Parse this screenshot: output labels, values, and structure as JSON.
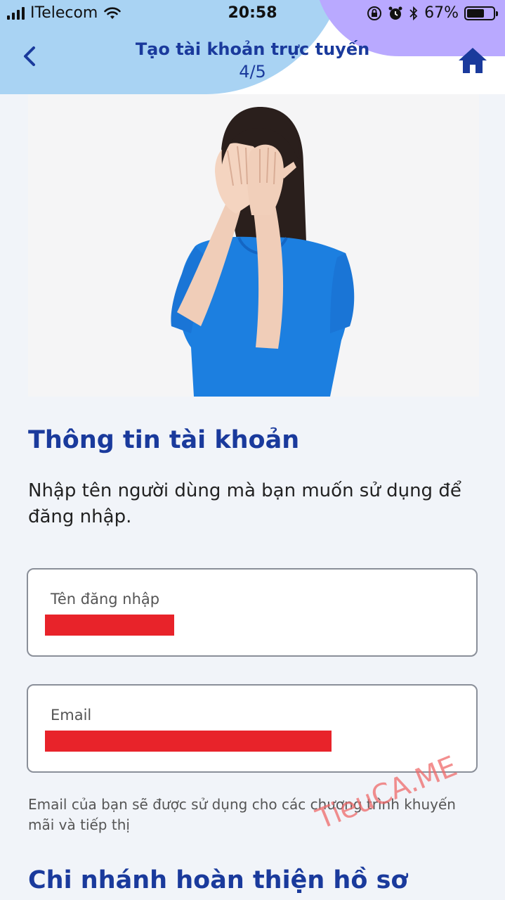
{
  "status_bar": {
    "carrier": "ITelecom",
    "time": "20:58",
    "battery_percent": "67%",
    "battery_level": 0.67
  },
  "header": {
    "title": "Tạo tài khoản trực tuyến",
    "step": "4/5",
    "back_icon": "chevron-left-icon",
    "home_icon": "home-icon"
  },
  "account_section": {
    "title": "Thông tin tài khoản",
    "description": "Nhập tên người dùng mà bạn muốn sử dụng để đăng nhập.",
    "username_field": {
      "label": "Tên đăng nhập"
    },
    "email_field": {
      "label": "Email"
    },
    "email_helper": "Email của bạn sẽ được sử dụng cho các chương trình khuyến mãi và tiếp thị"
  },
  "watermark": "TieuCA.ME",
  "next_section": {
    "title": "Chi nhánh hoàn thiện hồ sơ"
  },
  "colors": {
    "brand": "#1a3a9c",
    "redaction": "#e8232a",
    "blob_blue": "#a9d3f3",
    "blob_purple": "#b9a9ff"
  }
}
